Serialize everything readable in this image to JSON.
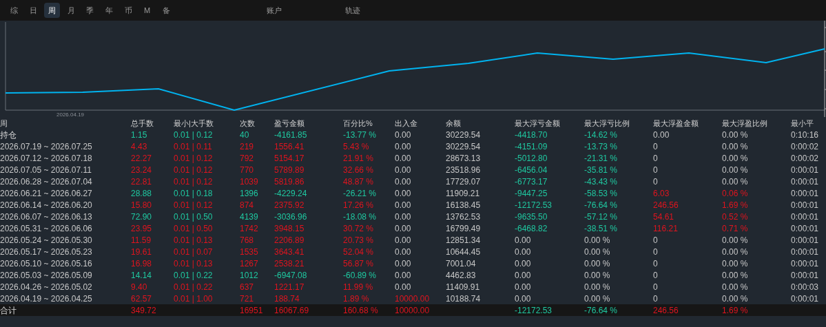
{
  "tabs": [
    {
      "label": "综",
      "selected": false
    },
    {
      "label": "日",
      "selected": false
    },
    {
      "label": "周",
      "selected": true
    },
    {
      "label": "月",
      "selected": false
    },
    {
      "label": "季",
      "selected": false
    },
    {
      "label": "年",
      "selected": false
    },
    {
      "label": "币",
      "selected": false
    },
    {
      "label": "M",
      "selected": false
    },
    {
      "label": "备",
      "selected": false
    }
  ],
  "side_tabs": [
    {
      "label": "账户",
      "selected": false
    },
    {
      "label": "轨迹",
      "selected": false
    }
  ],
  "chart": {
    "x_label": "2026.04.19"
  },
  "table": {
    "columns": [
      "周",
      "总手数",
      "最小|大手数",
      "次数",
      "盈亏金额",
      "百分比%",
      "出入金",
      "余额",
      "最大浮亏金额",
      "最大浮亏比例",
      "最大浮盈金额",
      "最大浮盈比例",
      "最小平"
    ],
    "rows": [
      {
        "kind": "position",
        "cells": [
          "持仓",
          {
            "text": "1.15",
            "color": "#1fc8a0"
          },
          {
            "text": "0.01 | 0.12",
            "color": "#1fc8a0"
          },
          {
            "text": "40",
            "color": "#1fc8a0"
          },
          {
            "text": "-4161.85",
            "color": "#1fc8a0"
          },
          {
            "text": "-13.77 %",
            "color": "#1fc8a0"
          },
          "0.00",
          "30229.54",
          {
            "text": "-4418.70",
            "color": "#1fc8a0"
          },
          {
            "text": "-14.62 %",
            "color": "#1fc8a0"
          },
          "0.00",
          "0.00 %",
          "0:10:16"
        ]
      },
      {
        "kind": "week",
        "cells": [
          "2026.07.19 ~ 2026.07.25",
          {
            "text": "4.43",
            "color": "#e0141e"
          },
          {
            "text": "0.01 | 0.11",
            "color": "#e0141e"
          },
          {
            "text": "219",
            "color": "#e0141e"
          },
          {
            "text": "1556.41",
            "color": "#e0141e"
          },
          {
            "text": "5.43 %",
            "color": "#e0141e"
          },
          "0.00",
          "30229.54",
          {
            "text": "-4151.09",
            "color": "#1fc8a0"
          },
          {
            "text": "-13.73 %",
            "color": "#1fc8a0"
          },
          "0",
          "0.00 %",
          "0:00:02"
        ]
      },
      {
        "kind": "week",
        "cells": [
          "2026.07.12 ~ 2026.07.18",
          {
            "text": "22.27",
            "color": "#e0141e"
          },
          {
            "text": "0.01 | 0.12",
            "color": "#e0141e"
          },
          {
            "text": "792",
            "color": "#e0141e"
          },
          {
            "text": "5154.17",
            "color": "#e0141e"
          },
          {
            "text": "21.91 %",
            "color": "#e0141e"
          },
          "0.00",
          "28673.13",
          {
            "text": "-5012.80",
            "color": "#1fc8a0"
          },
          {
            "text": "-21.31 %",
            "color": "#1fc8a0"
          },
          "0",
          "0.00 %",
          "0:00:02"
        ]
      },
      {
        "kind": "week",
        "cells": [
          "2026.07.05 ~ 2026.07.11",
          {
            "text": "23.24",
            "color": "#e0141e"
          },
          {
            "text": "0.01 | 0.12",
            "color": "#e0141e"
          },
          {
            "text": "770",
            "color": "#e0141e"
          },
          {
            "text": "5789.89",
            "color": "#e0141e"
          },
          {
            "text": "32.66 %",
            "color": "#e0141e"
          },
          "0.00",
          "23518.96",
          {
            "text": "-6456.04",
            "color": "#1fc8a0"
          },
          {
            "text": "-35.81 %",
            "color": "#1fc8a0"
          },
          "0",
          "0.00 %",
          "0:00:01"
        ]
      },
      {
        "kind": "week",
        "cells": [
          "2026.06.28 ~ 2026.07.04",
          {
            "text": "22.81",
            "color": "#e0141e"
          },
          {
            "text": "0.01 | 0.12",
            "color": "#e0141e"
          },
          {
            "text": "1039",
            "color": "#e0141e"
          },
          {
            "text": "5819.86",
            "color": "#e0141e"
          },
          {
            "text": "48.87 %",
            "color": "#e0141e"
          },
          "0.00",
          "17729.07",
          {
            "text": "-6773.17",
            "color": "#1fc8a0"
          },
          {
            "text": "-43.43 %",
            "color": "#1fc8a0"
          },
          "0",
          "0.00 %",
          "0:00:01"
        ]
      },
      {
        "kind": "week",
        "cells": [
          "2026.06.21 ~ 2026.06.27",
          {
            "text": "28.88",
            "color": "#1fc8a0"
          },
          {
            "text": "0.01 | 0.18",
            "color": "#1fc8a0"
          },
          {
            "text": "1396",
            "color": "#1fc8a0"
          },
          {
            "text": "-4229.24",
            "color": "#1fc8a0"
          },
          {
            "text": "-26.21 %",
            "color": "#1fc8a0"
          },
          "0.00",
          "11909.21",
          {
            "text": "-9447.25",
            "color": "#1fc8a0"
          },
          {
            "text": "-58.53 %",
            "color": "#1fc8a0"
          },
          {
            "text": "6.03",
            "color": "#e0141e"
          },
          {
            "text": "0.06 %",
            "color": "#e0141e"
          },
          "0:00:01"
        ]
      },
      {
        "kind": "week",
        "cells": [
          "2026.06.14 ~ 2026.06.20",
          {
            "text": "15.80",
            "color": "#e0141e"
          },
          {
            "text": "0.01 | 0.12",
            "color": "#e0141e"
          },
          {
            "text": "874",
            "color": "#e0141e"
          },
          {
            "text": "2375.92",
            "color": "#e0141e"
          },
          {
            "text": "17.26 %",
            "color": "#e0141e"
          },
          "0.00",
          "16138.45",
          {
            "text": "-12172.53",
            "color": "#1fc8a0"
          },
          {
            "text": "-76.64 %",
            "color": "#1fc8a0"
          },
          {
            "text": "246.56",
            "color": "#e0141e"
          },
          {
            "text": "1.69 %",
            "color": "#e0141e"
          },
          "0:00:01"
        ]
      },
      {
        "kind": "week",
        "cells": [
          "2026.06.07 ~ 2026.06.13",
          {
            "text": "72.90",
            "color": "#1fc8a0"
          },
          {
            "text": "0.01 | 0.50",
            "color": "#1fc8a0"
          },
          {
            "text": "4139",
            "color": "#1fc8a0"
          },
          {
            "text": "-3036.96",
            "color": "#1fc8a0"
          },
          {
            "text": "-18.08 %",
            "color": "#1fc8a0"
          },
          "0.00",
          "13762.53",
          {
            "text": "-9635.50",
            "color": "#1fc8a0"
          },
          {
            "text": "-57.12 %",
            "color": "#1fc8a0"
          },
          {
            "text": "54.61",
            "color": "#e0141e"
          },
          {
            "text": "0.52 %",
            "color": "#e0141e"
          },
          "0:00:01"
        ]
      },
      {
        "kind": "week",
        "cells": [
          "2026.05.31 ~ 2026.06.06",
          {
            "text": "23.95",
            "color": "#e0141e"
          },
          {
            "text": "0.01 | 0.50",
            "color": "#e0141e"
          },
          {
            "text": "1742",
            "color": "#e0141e"
          },
          {
            "text": "3948.15",
            "color": "#e0141e"
          },
          {
            "text": "30.72 %",
            "color": "#e0141e"
          },
          "0.00",
          "16799.49",
          {
            "text": "-6468.82",
            "color": "#1fc8a0"
          },
          {
            "text": "-38.51 %",
            "color": "#1fc8a0"
          },
          {
            "text": "116.21",
            "color": "#e0141e"
          },
          {
            "text": "0.71 %",
            "color": "#e0141e"
          },
          "0:00:01"
        ]
      },
      {
        "kind": "week",
        "cells": [
          "2026.05.24 ~ 2026.05.30",
          {
            "text": "11.59",
            "color": "#e0141e"
          },
          {
            "text": "0.01 | 0.13",
            "color": "#e0141e"
          },
          {
            "text": "768",
            "color": "#e0141e"
          },
          {
            "text": "2206.89",
            "color": "#e0141e"
          },
          {
            "text": "20.73 %",
            "color": "#e0141e"
          },
          "0.00",
          "12851.34",
          "0.00",
          "0.00 %",
          "0",
          "0.00 %",
          "0:00:01"
        ]
      },
      {
        "kind": "week",
        "cells": [
          "2026.05.17 ~ 2026.05.23",
          {
            "text": "19.61",
            "color": "#e0141e"
          },
          {
            "text": "0.01 | 0.07",
            "color": "#e0141e"
          },
          {
            "text": "1535",
            "color": "#e0141e"
          },
          {
            "text": "3643.41",
            "color": "#e0141e"
          },
          {
            "text": "52.04 %",
            "color": "#e0141e"
          },
          "0.00",
          "10644.45",
          "0.00",
          "0.00 %",
          "0",
          "0.00 %",
          "0:00:01"
        ]
      },
      {
        "kind": "week",
        "cells": [
          "2026.05.10 ~ 2026.05.16",
          {
            "text": "16.98",
            "color": "#e0141e"
          },
          {
            "text": "0.01 | 0.13",
            "color": "#e0141e"
          },
          {
            "text": "1267",
            "color": "#e0141e"
          },
          {
            "text": "2538.21",
            "color": "#e0141e"
          },
          {
            "text": "56.87 %",
            "color": "#e0141e"
          },
          "0.00",
          "7001.04",
          "0.00",
          "0.00 %",
          "0",
          "0.00 %",
          "0:00:01"
        ]
      },
      {
        "kind": "week",
        "cells": [
          "2026.05.03 ~ 2026.05.09",
          {
            "text": "14.14",
            "color": "#1fc8a0"
          },
          {
            "text": "0.01 | 0.22",
            "color": "#1fc8a0"
          },
          {
            "text": "1012",
            "color": "#1fc8a0"
          },
          {
            "text": "-6947.08",
            "color": "#1fc8a0"
          },
          {
            "text": "-60.89 %",
            "color": "#1fc8a0"
          },
          "0.00",
          "4462.83",
          "0.00",
          "0.00 %",
          "0",
          "0.00 %",
          "0:00:01"
        ]
      },
      {
        "kind": "week",
        "cells": [
          "2026.04.26 ~ 2026.05.02",
          {
            "text": "9.40",
            "color": "#e0141e"
          },
          {
            "text": "0.01 | 0.22",
            "color": "#e0141e"
          },
          {
            "text": "637",
            "color": "#e0141e"
          },
          {
            "text": "1221.17",
            "color": "#e0141e"
          },
          {
            "text": "11.99 %",
            "color": "#e0141e"
          },
          "0.00",
          "11409.91",
          "0.00",
          "0.00 %",
          "0",
          "0.00 %",
          "0:00:03"
        ]
      },
      {
        "kind": "week",
        "cells": [
          "2026.04.19 ~ 2026.04.25",
          {
            "text": "62.57",
            "color": "#e0141e"
          },
          {
            "text": "0.01 | 1.00",
            "color": "#e0141e"
          },
          {
            "text": "721",
            "color": "#e0141e"
          },
          {
            "text": "188.74",
            "color": "#e0141e"
          },
          {
            "text": "1.89 %",
            "color": "#e0141e"
          },
          {
            "text": "10000.00",
            "color": "#e0141e"
          },
          "10188.74",
          "0.00",
          "0.00 %",
          "0",
          "0.00 %",
          "0:00:01"
        ]
      },
      {
        "kind": "total",
        "cells": [
          "合计",
          {
            "text": "349.72",
            "color": "#e0141e"
          },
          "",
          {
            "text": "16951",
            "color": "#e0141e"
          },
          {
            "text": "16067.69",
            "color": "#e0141e"
          },
          {
            "text": "160.68 %",
            "color": "#e0141e"
          },
          {
            "text": "10000.00",
            "color": "#e0141e"
          },
          "",
          {
            "text": "-12172.53",
            "color": "#1fc8a0"
          },
          {
            "text": "-76.64 %",
            "color": "#1fc8a0"
          },
          {
            "text": "246.56",
            "color": "#e0141e"
          },
          {
            "text": "1.69 %",
            "color": "#e0141e"
          },
          ""
        ]
      }
    ]
  }
}
